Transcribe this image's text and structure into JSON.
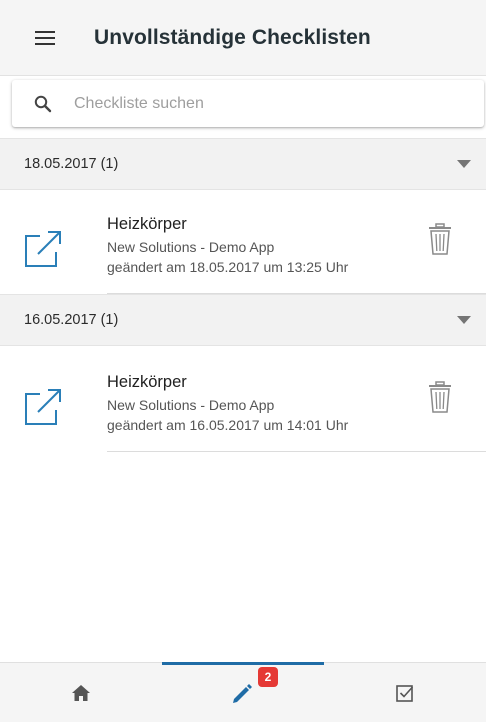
{
  "header": {
    "title": "Unvollständige Checklisten",
    "menu_icon": "hamburger-menu-icon"
  },
  "search": {
    "placeholder": "Checkliste suchen",
    "value": ""
  },
  "groups": [
    {
      "title": "18.05.2017 (1)",
      "items": [
        {
          "title": "Heizkörper",
          "subtitle": "New Solutions - Demo App",
          "changed": "geändert am 18.05.2017 um 13:25 Uhr"
        }
      ]
    },
    {
      "title": "16.05.2017 (1)",
      "items": [
        {
          "title": "Heizkörper",
          "subtitle": "New Solutions - Demo App",
          "changed": "geändert am 16.05.2017 um 14:01 Uhr"
        }
      ]
    }
  ],
  "bottom_nav": {
    "items": [
      {
        "icon": "home-icon",
        "active": false
      },
      {
        "icon": "pencil-icon",
        "active": true,
        "badge": "2"
      },
      {
        "icon": "checkbox-icon",
        "active": false
      }
    ]
  },
  "colors": {
    "accent": "#1f6ca6",
    "badge": "#e53935",
    "header_bg": "#f5f5f5"
  }
}
